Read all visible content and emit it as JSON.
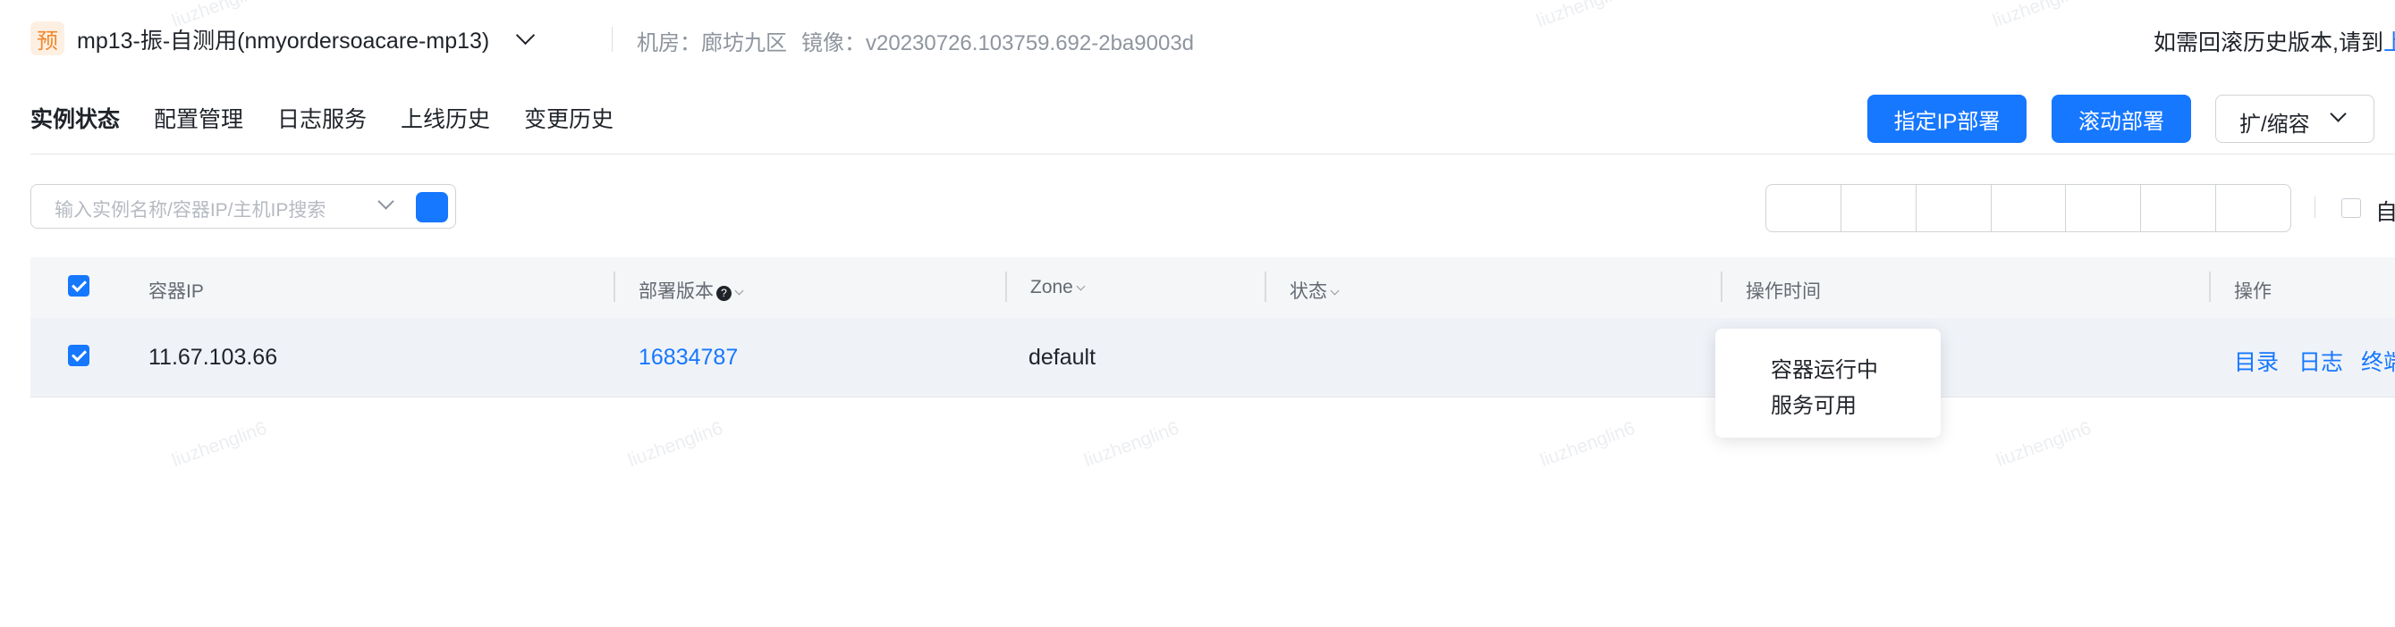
{
  "header": {
    "badge": "预",
    "app_title": "mp13-振-自测用(nmyordersoacare-mp13)",
    "room": "机房：廊坊九区",
    "image": "镜像：v20230726.103759.692-2ba9003d",
    "notice": "如需回滚历史版本,请到",
    "notice_link": "上"
  },
  "tabs": [
    "实例状态",
    "配置管理",
    "日志服务",
    "上线历史",
    "变更历史"
  ],
  "actions": {
    "specify_ip_deploy": "指定IP部署",
    "rolling_deploy": "滚动部署",
    "scale": "扩/缩容"
  },
  "search": {
    "placeholder": "输入实例名称/容器IP/主机IP搜索"
  },
  "auto_label": "自",
  "table": {
    "headers": {
      "container_ip": "容器IP",
      "deploy_version": "部署版本",
      "help_icon": "?",
      "zone": "Zone",
      "status": "状态",
      "op_time": "操作时间",
      "operation": "操作"
    },
    "rows": [
      {
        "container_ip": "11.67.103.66",
        "deploy_version": "16834787",
        "zone": "default",
        "ops": [
          "目录",
          "日志",
          "终端"
        ]
      }
    ]
  },
  "tooltip": {
    "line1": "容器运行中",
    "line2": "服务可用"
  },
  "watermark": "liuzhenglin6",
  "colors": {
    "accent": "#1677ff",
    "badge_bg": "#fdf0e3",
    "badge_fg": "#f0892d",
    "row_bg": "#eff3f8"
  }
}
